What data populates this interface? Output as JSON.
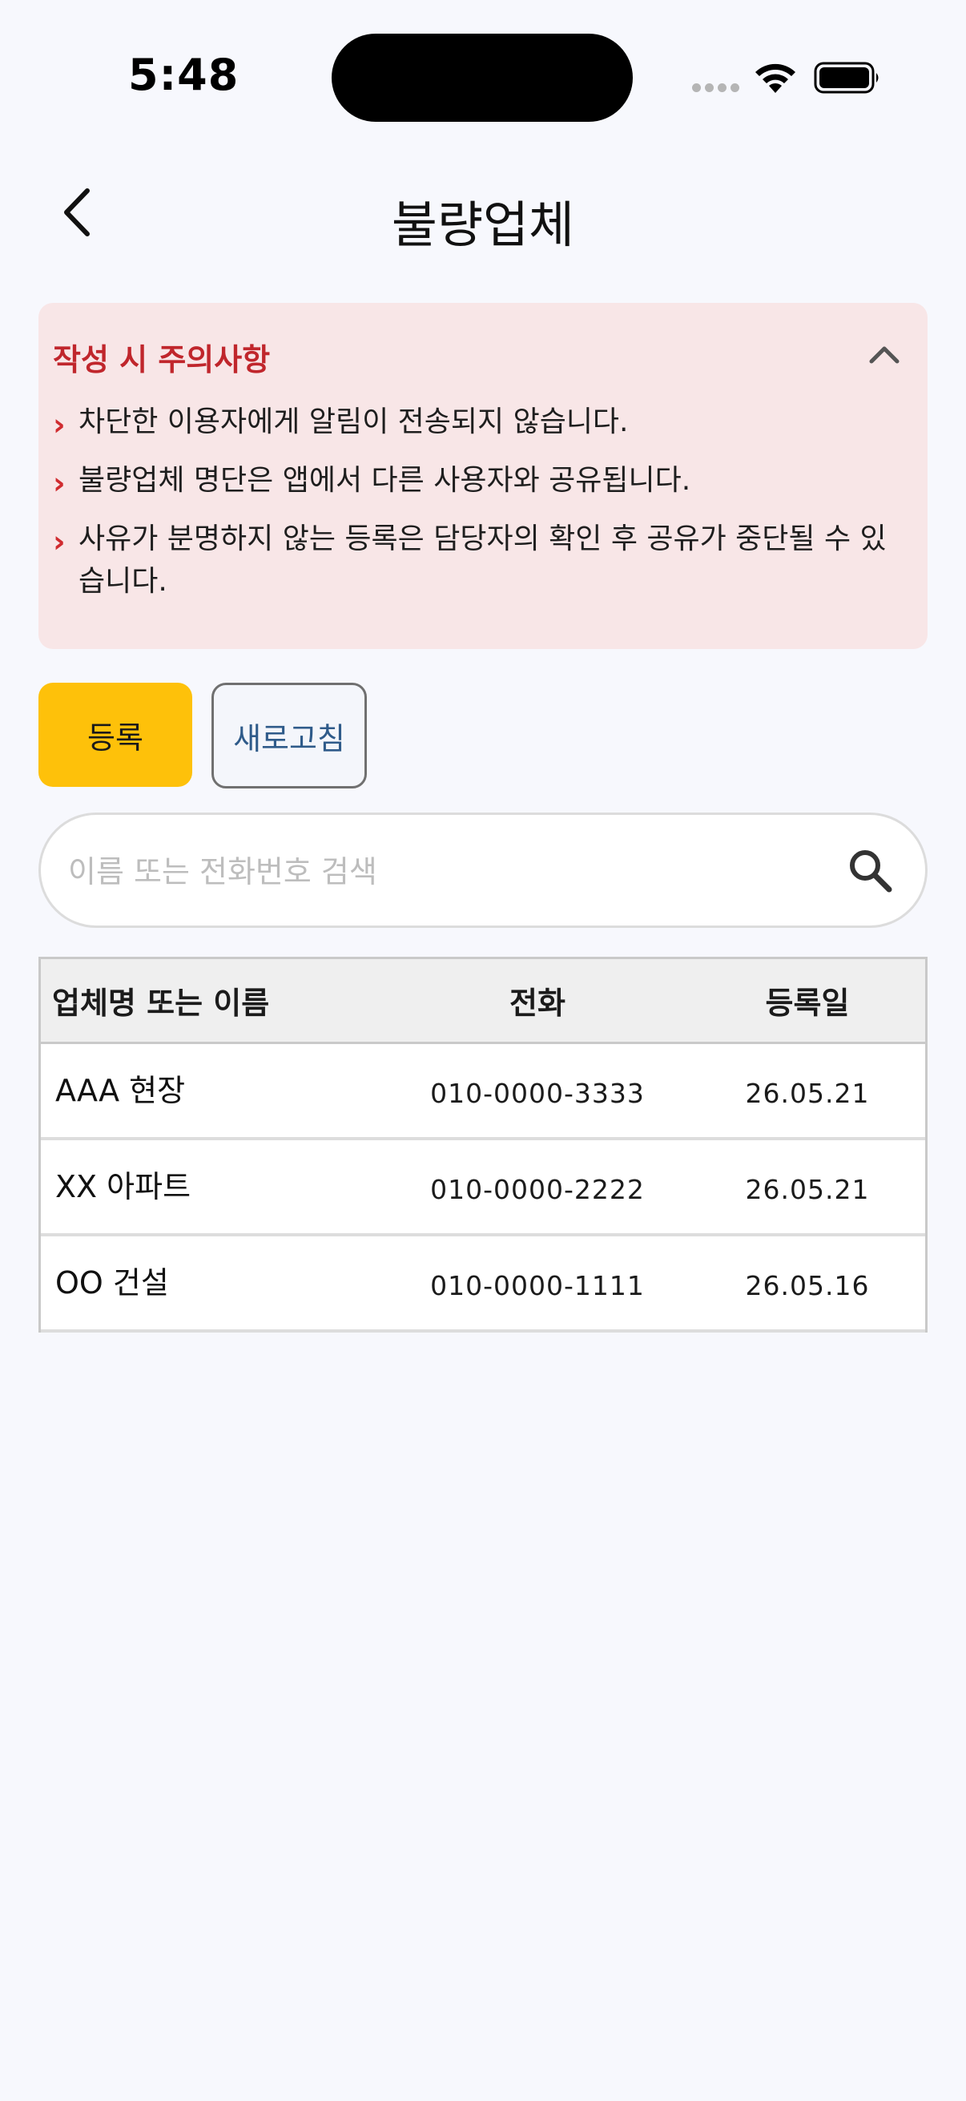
{
  "status_bar": {
    "time": "5:48"
  },
  "header": {
    "title": "불량업체"
  },
  "notice": {
    "title": "작성 시 주의사항",
    "items": [
      "차단한 이용자에게 알림이 전송되지 않습니다.",
      "불량업체 명단은 앱에서 다른 사용자와 공유됩니다.",
      "사유가 분명하지 않는 등록은 담당자의 확인 후 공유가 중단될 수 있습니다."
    ]
  },
  "actions": {
    "register_label": "등록",
    "refresh_label": "새로고침"
  },
  "search": {
    "placeholder": "이름 또는 전화번호 검색",
    "value": ""
  },
  "table": {
    "columns": [
      "업체명 또는 이름",
      "전화",
      "등록일"
    ],
    "rows": [
      {
        "name": "AAA 현장",
        "phone": "010-0000-3333",
        "date": "26.05.21"
      },
      {
        "name": "XX 아파트",
        "phone": "010-0000-2222",
        "date": "26.05.21"
      },
      {
        "name": "OO 건설",
        "phone": "010-0000-1111",
        "date": "26.05.16"
      }
    ]
  },
  "colors": {
    "accent": "#fec10a",
    "notice_bg": "#f8e6e7",
    "notice_title": "#c0262c",
    "refresh_text": "#2f5b8a"
  }
}
